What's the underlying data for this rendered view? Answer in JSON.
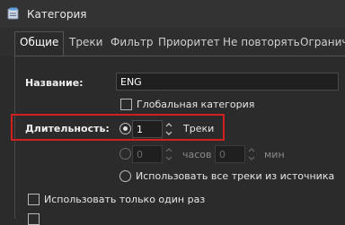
{
  "window": {
    "title": "Категория"
  },
  "tabs": [
    "Общие",
    "Треки",
    "Фильтр",
    "Приоритет",
    "Не повторять",
    "Огранич"
  ],
  "form": {
    "name_label": "Название:",
    "name_value": "ENG",
    "global_category_label": "Глобальная категория",
    "duration_label": "Длительность:",
    "tracks_count": "1",
    "tracks_unit": "Треки",
    "hours_value": "0",
    "hours_unit": "часов",
    "minutes_value": "0",
    "minutes_unit": "мин",
    "use_all_label": "Использовать все треки из источника",
    "only_one_label": "Использовать только один раз"
  },
  "colors": {
    "highlight": "#d21f1f",
    "background": "#2b2b2b"
  }
}
